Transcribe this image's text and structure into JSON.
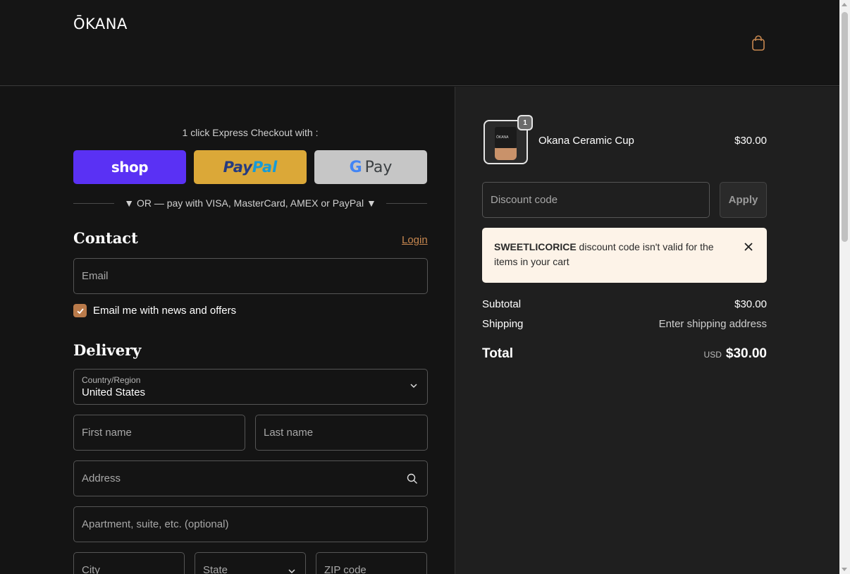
{
  "brand": {
    "logo_text": "ŌKANA"
  },
  "header": {
    "cart_icon": "shopping-bag-icon",
    "accent": "#c7874f"
  },
  "express": {
    "label": "1 click Express Checkout with :",
    "shop_label": "shop",
    "paypal_part1": "Pay",
    "paypal_part2": "Pal",
    "gpay_g": "G",
    "gpay_label": "Pay",
    "or_text": "▼ OR — pay with VISA, MasterCard, AMEX or PayPal ▼"
  },
  "contact": {
    "title": "Contact",
    "login_label": "Login",
    "email_placeholder": "Email",
    "newsletter_label": "Email me with news and offers",
    "newsletter_checked": true
  },
  "delivery": {
    "title": "Delivery",
    "country_label": "Country/Region",
    "country_value": "United States",
    "first_name_placeholder": "First name",
    "last_name_placeholder": "Last name",
    "address_placeholder": "Address",
    "apartment_placeholder": "Apartment, suite, etc. (optional)",
    "city_placeholder": "City",
    "state_label": "State",
    "zip_placeholder": "ZIP code"
  },
  "order": {
    "item": {
      "name": "Okana Ceramic Cup",
      "price": "$30.00",
      "quantity": "1",
      "thumb_text": "ŌKANA"
    },
    "discount_placeholder": "Discount code",
    "apply_label": "Apply",
    "alert": {
      "code": "SWEETLICORICE",
      "message": " discount code isn't valid for the items in your cart"
    },
    "subtotal_label": "Subtotal",
    "subtotal_value": "$30.00",
    "shipping_label": "Shipping",
    "shipping_value": "Enter shipping address",
    "total_label": "Total",
    "currency": "USD",
    "total_value": "$30.00"
  }
}
